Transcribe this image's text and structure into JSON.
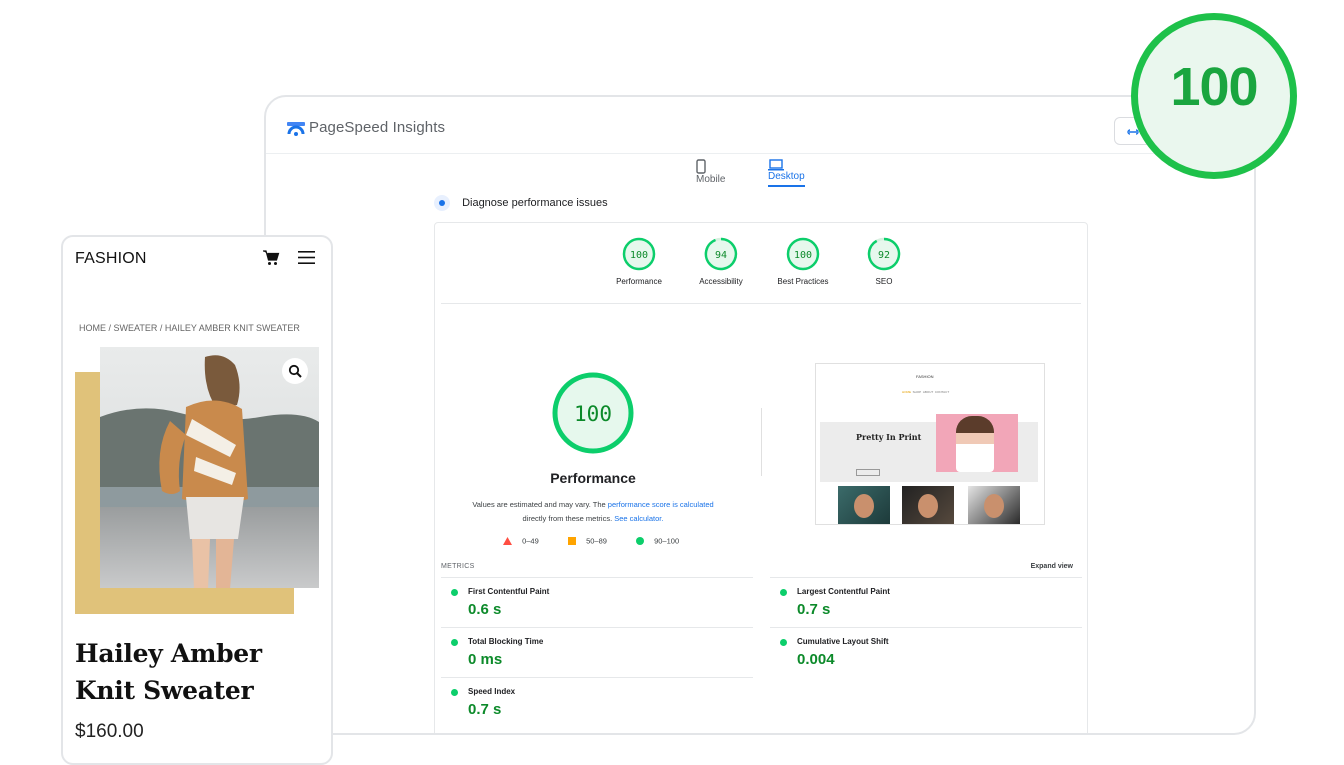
{
  "psi": {
    "app_title": "PageSpeed Insights",
    "tabs": [
      {
        "label": "Mobile",
        "active": false
      },
      {
        "label": "Desktop",
        "active": true
      }
    ],
    "diagnose_label": "Diagnose performance issues",
    "categories": [
      {
        "label": "Performance",
        "score": "100"
      },
      {
        "label": "Accessibility",
        "score": "94"
      },
      {
        "label": "Best Practices",
        "score": "100"
      },
      {
        "label": "SEO",
        "score": "92"
      }
    ],
    "main_score": "100",
    "main_label": "Performance",
    "note_prefix": "Values are estimated and may vary. The ",
    "note_link1": "performance score is calculated",
    "note_middle": "directly from these metrics. ",
    "note_link2": "See calculator.",
    "legend": [
      {
        "range": "0–49",
        "shape": "triangle",
        "color": "#ff4e42"
      },
      {
        "range": "50–89",
        "shape": "square",
        "color": "#ffa400"
      },
      {
        "range": "90–100",
        "shape": "circle",
        "color": "#0cce6b"
      }
    ],
    "preview": {
      "brand": "FASHION",
      "nav": [
        "HOME",
        "SHOP",
        "ABOUT",
        "CONTACT"
      ],
      "hero_title": "Pretty In Print"
    },
    "metrics_heading": "METRICS",
    "expand_label": "Expand view",
    "metrics": [
      {
        "name": "First Contentful Paint",
        "value": "0.6 s"
      },
      {
        "name": "Largest Contentful Paint",
        "value": "0.7 s"
      },
      {
        "name": "Total Blocking Time",
        "value": "0 ms"
      },
      {
        "name": "Cumulative Layout Shift",
        "value": "0.004"
      },
      {
        "name": "Speed Index",
        "value": "0.7 s"
      }
    ]
  },
  "badge": {
    "score": "100",
    "color": "#1ec14a"
  },
  "product": {
    "brand": "FASHION",
    "breadcrumb": "HOME / SWEATER / HAILEY AMBER KNIT SWEATER",
    "title": "Hailey Amber Knit Sweater",
    "price": "$160.00"
  },
  "colors": {
    "accent": "#1a73e8",
    "pass": "#0cce6b",
    "gold": "#e0c27a"
  }
}
